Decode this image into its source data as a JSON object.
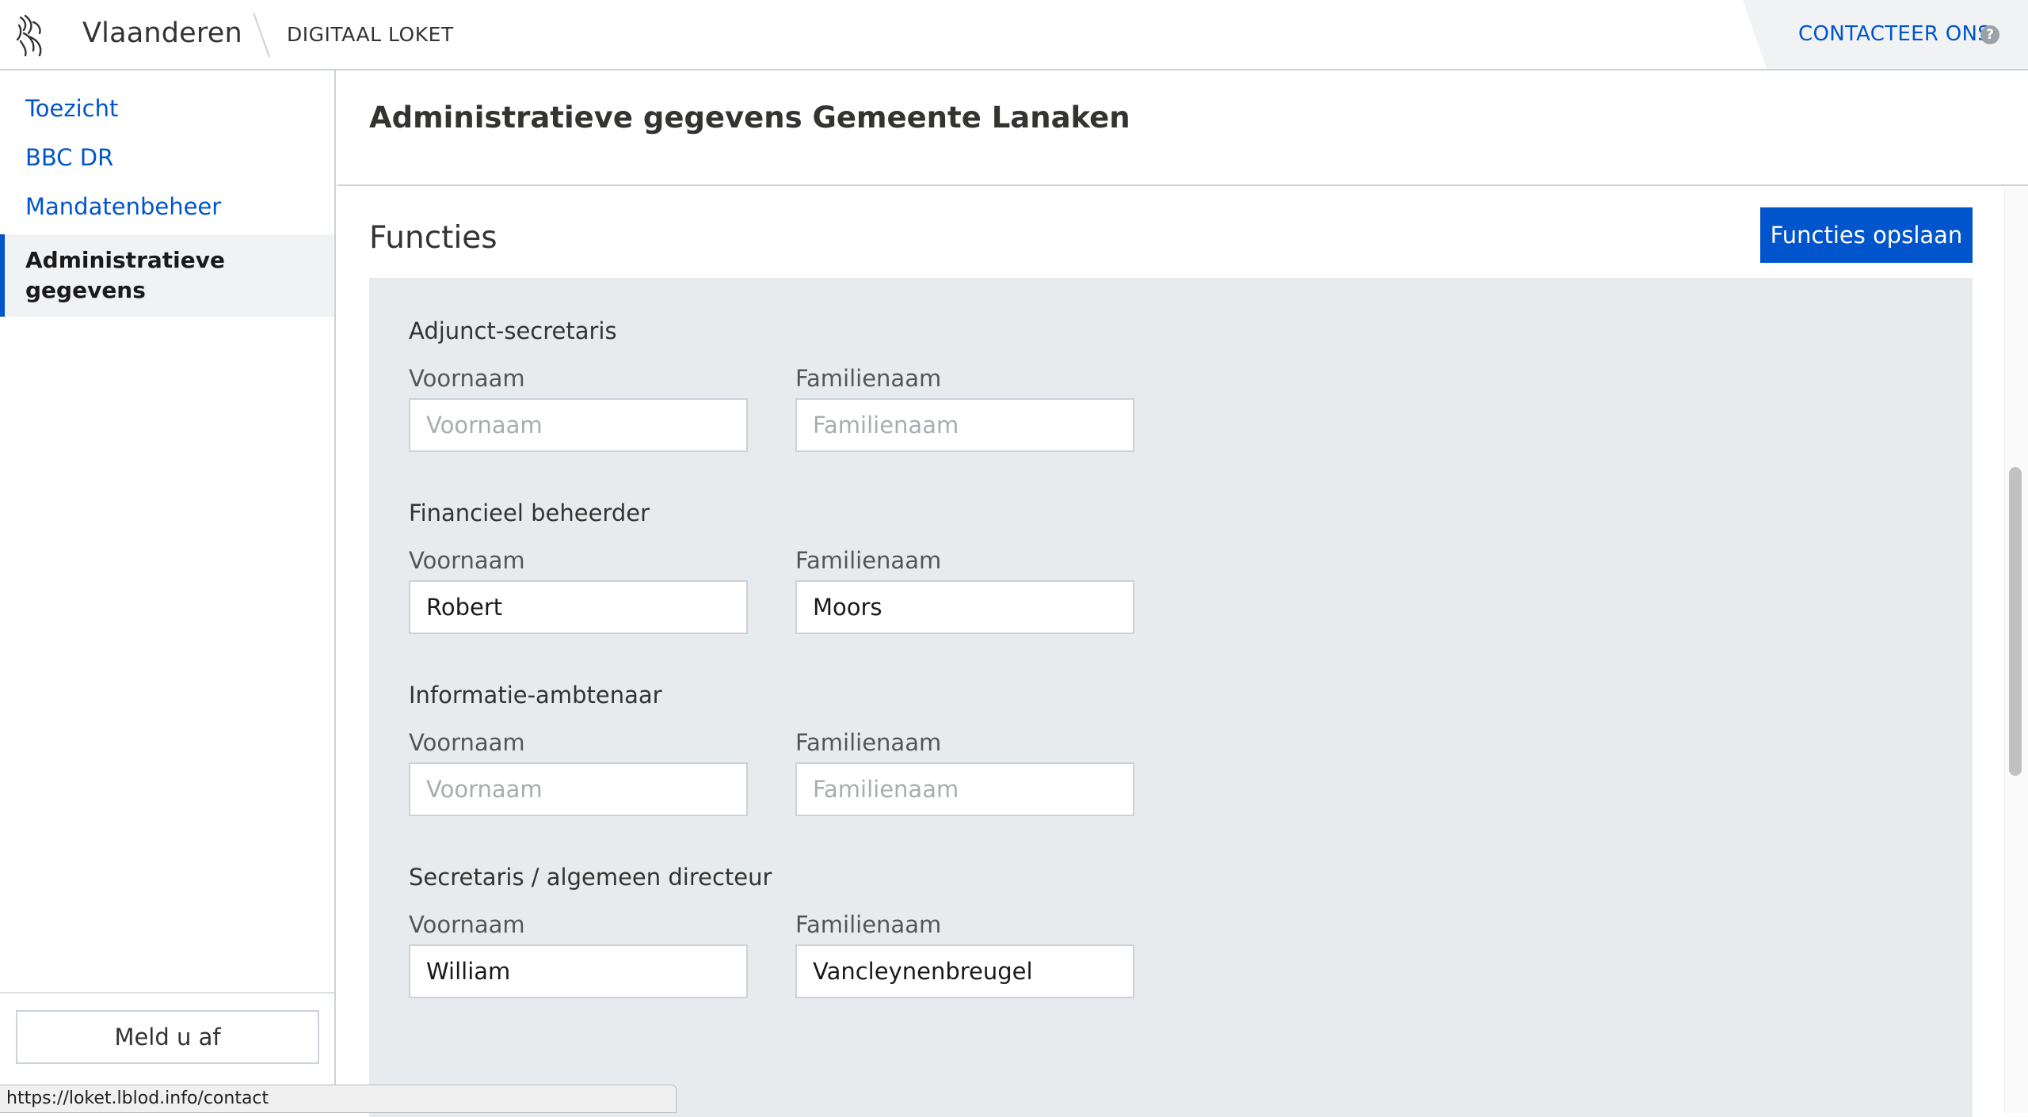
{
  "header": {
    "brand": "Vlaanderen",
    "app_name": "DIGITAAL LOKET",
    "contact_label": "CONTACTEER ONS",
    "help_glyph": "?",
    "logo_icon": "flemish-lion-icon"
  },
  "sidebar": {
    "items": [
      {
        "label": "Toezicht"
      },
      {
        "label": "BBC DR"
      },
      {
        "label": "Mandatenbeheer"
      },
      {
        "label": "Administratieve gegevens",
        "active": true
      }
    ],
    "logout_label": "Meld u af"
  },
  "main": {
    "page_title": "Administratieve gegevens Gemeente Lanaken",
    "section_title": "Functies",
    "save_label": "Functies opslaan",
    "groups": [
      {
        "title": "Adjunct-secretaris",
        "first_name_label": "Voornaam",
        "last_name_label": "Familienaam",
        "first_name_value": "",
        "last_name_value": "",
        "first_name_placeholder": "Voornaam",
        "last_name_placeholder": "Familienaam"
      },
      {
        "title": "Financieel beheerder",
        "first_name_label": "Voornaam",
        "last_name_label": "Familienaam",
        "first_name_value": "Robert",
        "last_name_value": "Moors",
        "first_name_placeholder": "Voornaam",
        "last_name_placeholder": "Familienaam"
      },
      {
        "title": "Informatie-ambtenaar",
        "first_name_label": "Voornaam",
        "last_name_label": "Familienaam",
        "first_name_value": "",
        "last_name_value": "",
        "first_name_placeholder": "Voornaam",
        "last_name_placeholder": "Familienaam"
      },
      {
        "title": "Secretaris / algemeen directeur",
        "first_name_label": "Voornaam",
        "last_name_label": "Familienaam",
        "first_name_value": "William",
        "last_name_value": "Vancleynenbreugel",
        "first_name_placeholder": "Voornaam",
        "last_name_placeholder": "Familienaam"
      }
    ]
  },
  "status_bar": {
    "url": "https://loket.lblod.info/contact"
  },
  "colors": {
    "accent": "#0055cc",
    "panel_bg": "#e8ebee",
    "active_nav_bg": "#f1f2f4",
    "border": "#cbd2da"
  }
}
